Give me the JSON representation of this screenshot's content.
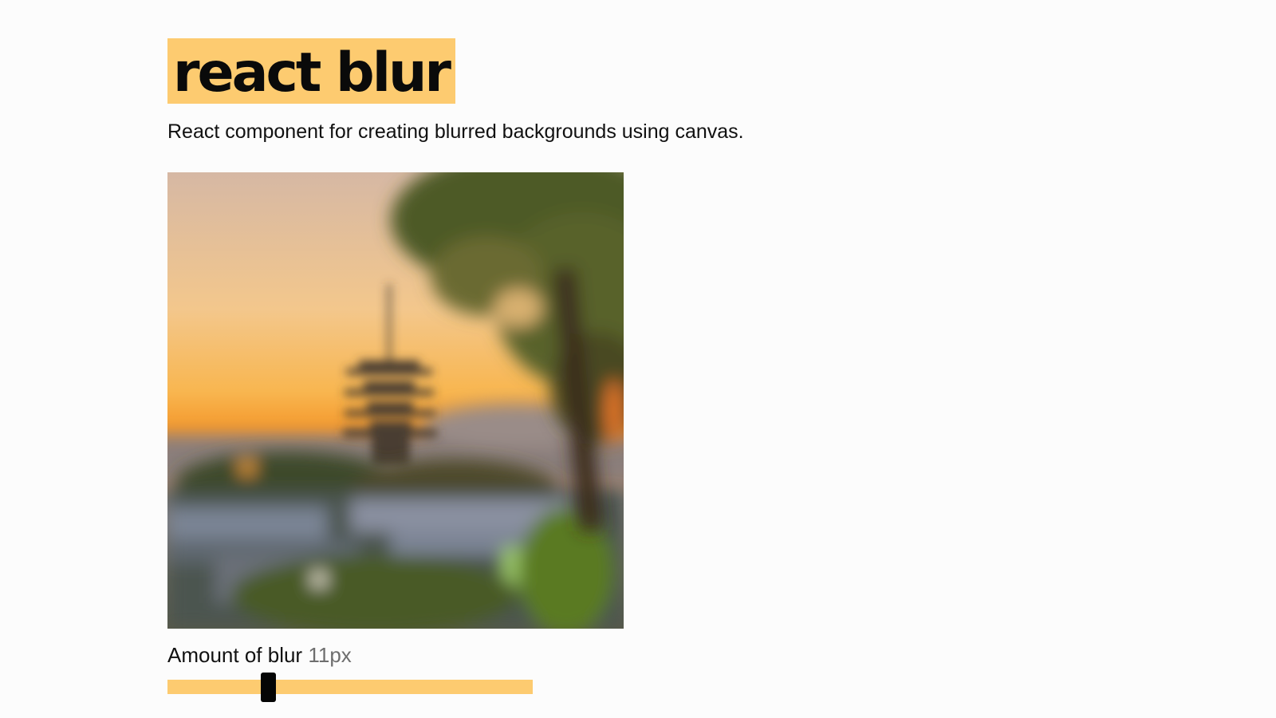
{
  "header": {
    "title": "react blur",
    "subtitle": "React component for creating blurred backgrounds using canvas."
  },
  "demo": {
    "image_alt": "blurred pagoda at sunset",
    "blur": {
      "label": "Amount of blur",
      "value_text": "11px",
      "value": 11,
      "min": 0,
      "max": 40
    }
  },
  "colors": {
    "accent": "#fdcb70",
    "background": "#fcfcfc",
    "text": "#111111",
    "muted": "#6e6e6e",
    "thumb": "#050505"
  }
}
